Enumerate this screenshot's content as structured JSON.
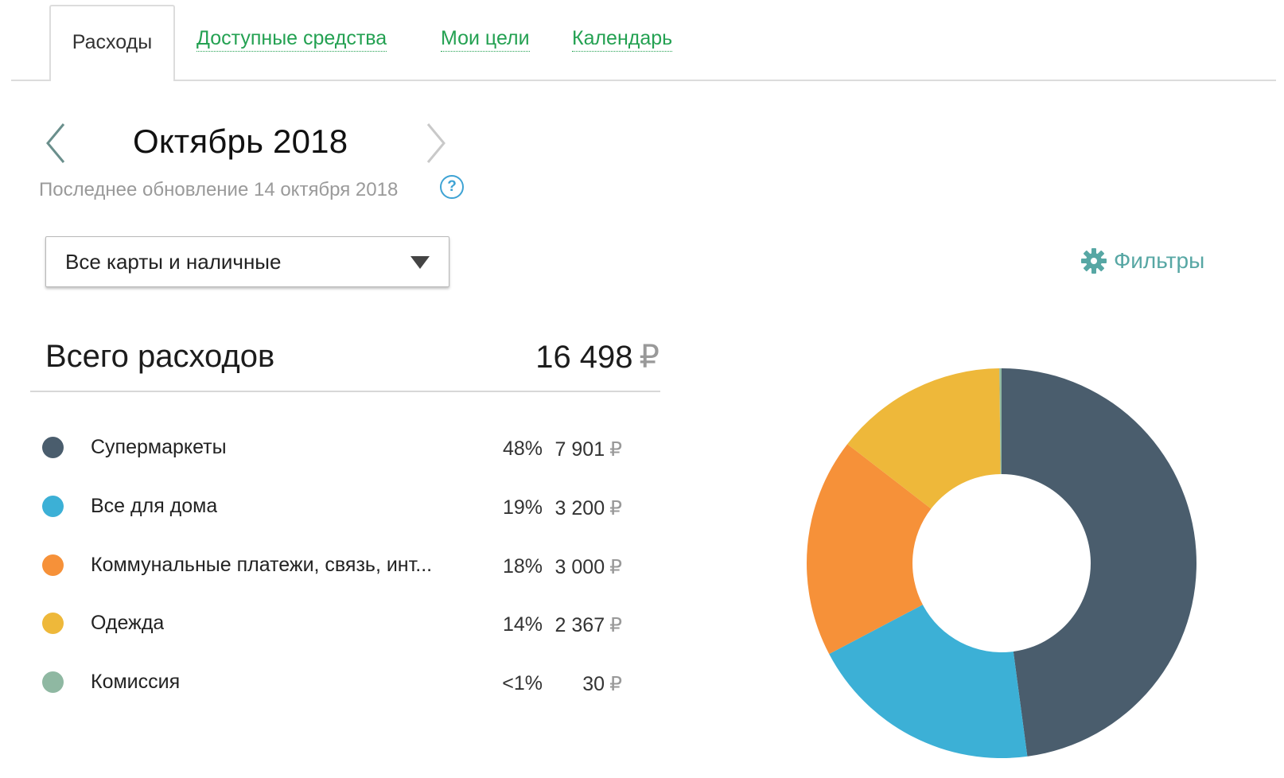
{
  "tabs": [
    {
      "label": "Расходы",
      "active": true
    },
    {
      "label": "Доступные средства",
      "active": false
    },
    {
      "label": "Мои цели",
      "active": false
    },
    {
      "label": "Календарь",
      "active": false
    }
  ],
  "period": {
    "month_label": "Октябрь 2018",
    "updated_text": "Последнее обновление 14 октября 2018",
    "help_icon_text": "?",
    "prev_icon": "chevron-left-icon",
    "next_icon": "chevron-right-icon"
  },
  "account_select": {
    "value": "Все карты и наличные"
  },
  "filters": {
    "label": "Фильтры",
    "icon": "gear-icon",
    "color": "#57a7a4"
  },
  "total": {
    "label": "Всего расходов",
    "amount": "16 498",
    "currency": "₽"
  },
  "categories": [
    {
      "name": "Супермаркеты",
      "percent": "48%",
      "amount": "7 901",
      "currency": "₽",
      "color": "#4a5d6d"
    },
    {
      "name": "Все для дома",
      "percent": "19%",
      "amount": "3 200",
      "currency": "₽",
      "color": "#3cb0d6"
    },
    {
      "name": "Коммунальные платежи, связь, инт...",
      "percent": "18%",
      "amount": "3 000",
      "currency": "₽",
      "color": "#f69139"
    },
    {
      "name": "Одежда",
      "percent": "14%",
      "amount": "2 367",
      "currency": "₽",
      "color": "#eeb83a"
    },
    {
      "name": "Комиссия",
      "percent": "<1%",
      "amount": "30",
      "currency": "₽",
      "color": "#8fb8a2"
    }
  ],
  "chart_data": {
    "type": "pie",
    "donut": true,
    "categories": [
      "Супермаркеты",
      "Все для дома",
      "Коммунальные платежи, связь, инт...",
      "Одежда",
      "Комиссия"
    ],
    "values": [
      7901,
      3200,
      3000,
      2367,
      30
    ],
    "colors": [
      "#4a5d6d",
      "#3cb0d6",
      "#f69139",
      "#eeb83a",
      "#8fb8a2"
    ],
    "start": "top",
    "direction": "clockwise"
  }
}
